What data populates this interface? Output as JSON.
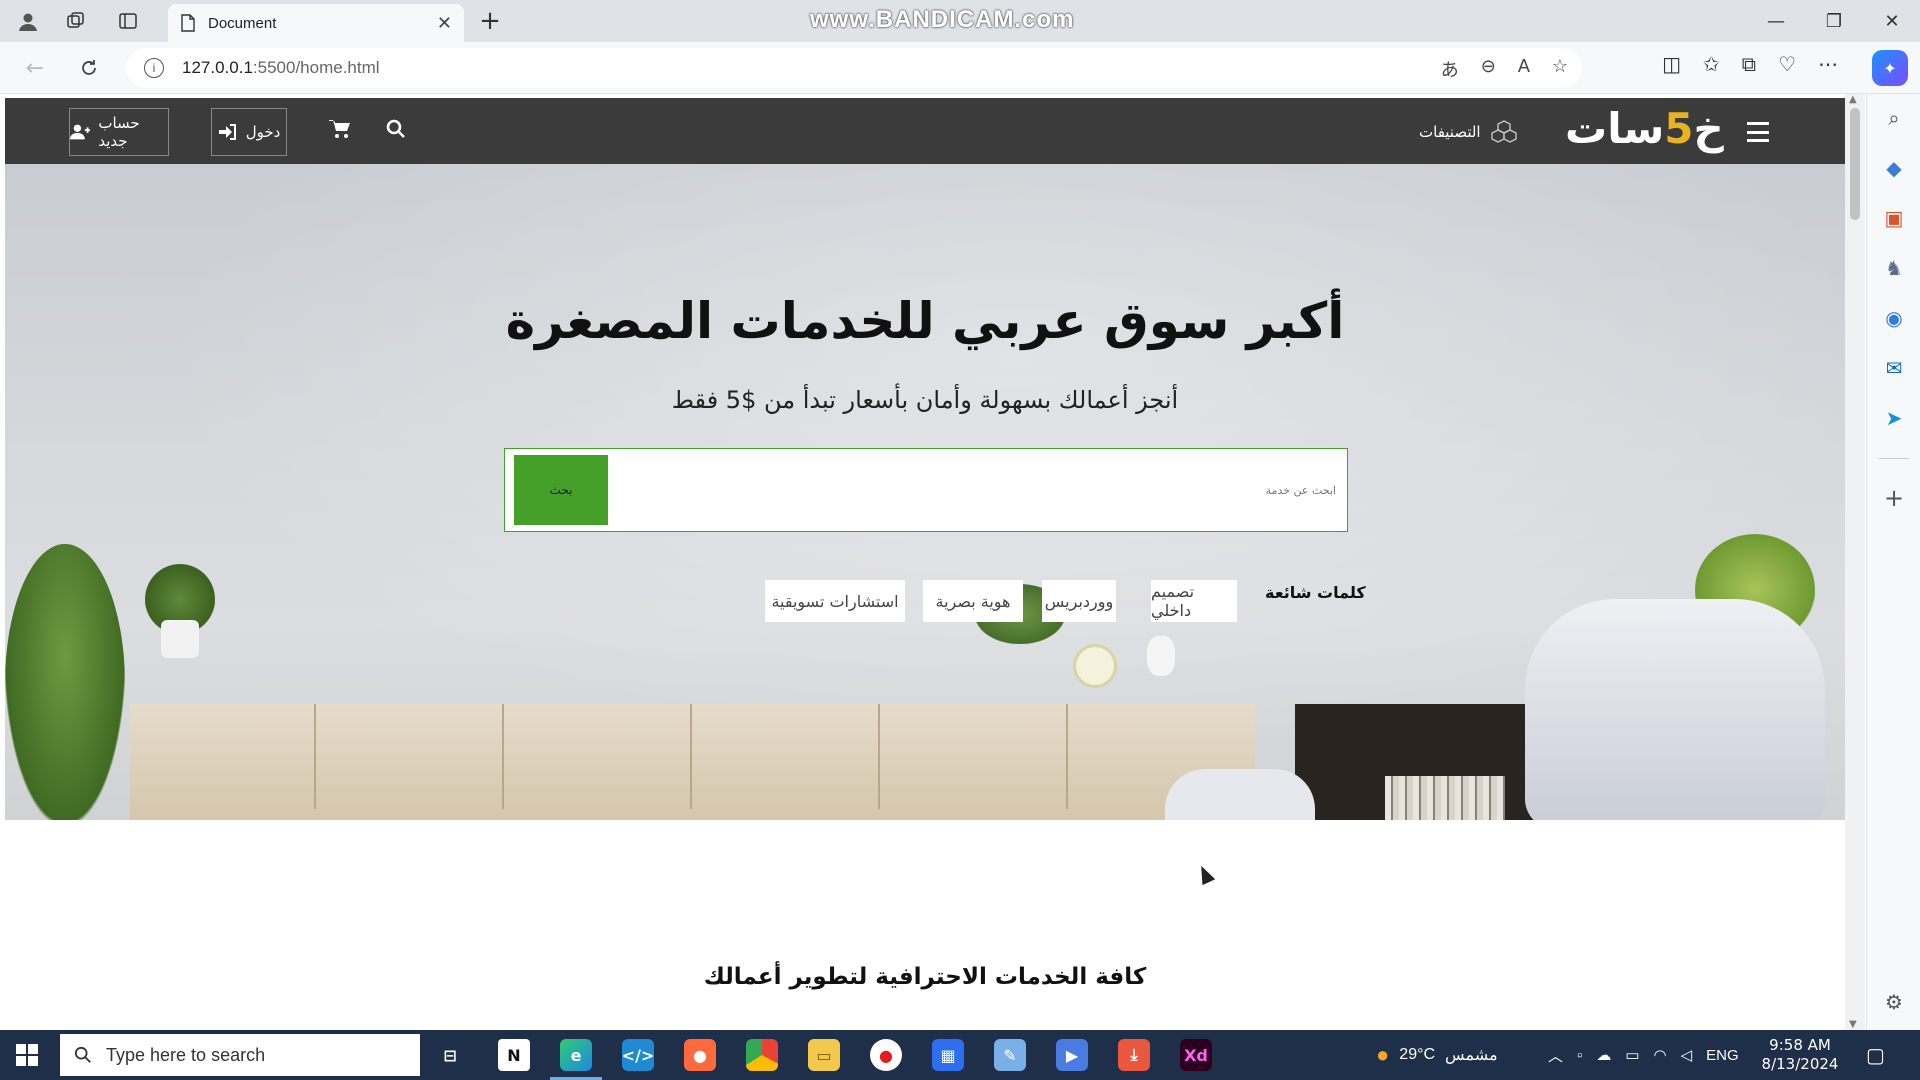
{
  "browser": {
    "tab_title": "Document",
    "url_host": "127.0.0.1",
    "url_rest": ":5500/home.html",
    "watermark": "www.BANDICAM.com"
  },
  "site": {
    "brand": {
      "before": "خ",
      "five": "5",
      "after": "سات"
    },
    "categories_label": "التصنيفات",
    "login_label": "دخول",
    "signup_label": "حساب جديد",
    "hero_title": "أكبر سوق عربي للخدمات المصغرة",
    "hero_subtitle": "أنجز أعمالك بسهولة وأمان بأسعار تبدأ من $5 فقط",
    "search_placeholder": "ابحث عن خدمة",
    "search_button": "بحث",
    "popular_label": "كلمات شائعة",
    "popular_tags": [
      "تصميم داخلي",
      "ووردبريس",
      "هوية بصرية",
      "استشارات تسويقية"
    ],
    "section_title": "كافة الخدمات الاحترافية لتطوير أعمالك",
    "colors": {
      "nav_bg": "#3b3b3b",
      "accent_green": "#45a02a",
      "brand_five": "#e8b321"
    }
  },
  "taskbar": {
    "search_placeholder": "Type here to search",
    "weather_temp": "29°C",
    "weather_desc": "مشمس",
    "language": "ENG",
    "time": "9:58 AM",
    "date": "8/13/2024"
  }
}
